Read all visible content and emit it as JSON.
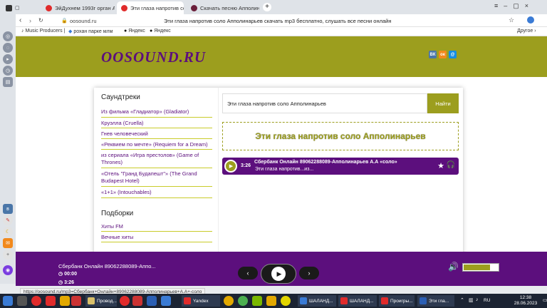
{
  "browser": {
    "tabs": [
      {
        "label": "",
        "favicon_color": "#333333"
      },
      {
        "label": "ЭйДухнем 1993г орган Am",
        "favicon_color": "#e02b2b"
      },
      {
        "label": "Эти глаза напротив соло",
        "favicon_color": "#e02b2b"
      },
      {
        "label": "Скачать песню Апполинарь",
        "favicon_color": "#6a1e3a"
      }
    ],
    "new_tab": "+",
    "address": "oosound.ru",
    "page_title": "Эти глаза напротив соло Апполинарьев скачать mp3 бесплатно, слушать все песни онлайн",
    "bookmarks": [
      "Music Producers |",
      "рохан парке млм",
      "Яндекс",
      "Яндекс"
    ],
    "bookmarks_other": "Другое"
  },
  "site": {
    "logo": "OOSOUND.RU",
    "social": [
      {
        "name": "vk-icon",
        "label": "ВК",
        "color": "#4a76a8"
      },
      {
        "name": "odnoklassniki-icon",
        "label": "ок",
        "color": "#f2891c"
      },
      {
        "name": "moimir-icon",
        "label": "@",
        "color": "#168de2"
      }
    ],
    "soundtracks_title": "Саундтреки",
    "soundtracks": [
      "Из фильма «Гладиатор» (Gladiator)",
      "Круэлла (Cruella)",
      "Гнев человеческий",
      "«Реквием по мечте» (Requiem for a Dream)",
      "из сериала «Игра престолов» (Game of Thrones)",
      "«Отель \"Гранд Будапешт\"» (The Grand Budapest Hotel)",
      "«1+1» (Intouchables)"
    ],
    "collections_title": "Подборки",
    "collections": [
      "Хиты FM",
      "Вечные хиты"
    ],
    "search_value": "Эти глаза напротив соло Апполинарьев",
    "search_button": "Найти",
    "page_heading": "Эти глаза напротив соло Апполинарьев",
    "track": {
      "duration": "3:26",
      "artist": "Сбербанк Онлайн 89062288089-Апполинарьев А.А «соло»",
      "title": "Эти глаза напротив...из..."
    }
  },
  "player": {
    "artist": "Сбербанк Онлайн 89062288089-Аппо...",
    "time_current": "00:00",
    "time_total": "3:26",
    "prev_icon": "‹",
    "next_icon": "›",
    "volume_level": 0.78
  },
  "status_url": "https://oosound.ru/mp3=Сбербанк+Онлайн+89062288089-Апполинарьев+А.А+-соло",
  "taskbar": {
    "items": [
      {
        "label": "Провод...",
        "color": "#d9c06a"
      },
      {
        "label": "Yandex",
        "color": "#e02b2b"
      },
      {
        "label": "ШАЛАНД...",
        "color": "#3a7bd5"
      },
      {
        "label": "ШАЛАНД...",
        "color": "#e02b2b"
      },
      {
        "label": "Проигры...",
        "color": "#e02b2b"
      },
      {
        "label": "Эти гла...",
        "color": "#2b5fb4"
      }
    ],
    "lang": "RU",
    "time": "12:38",
    "date": "28.06.2023"
  }
}
